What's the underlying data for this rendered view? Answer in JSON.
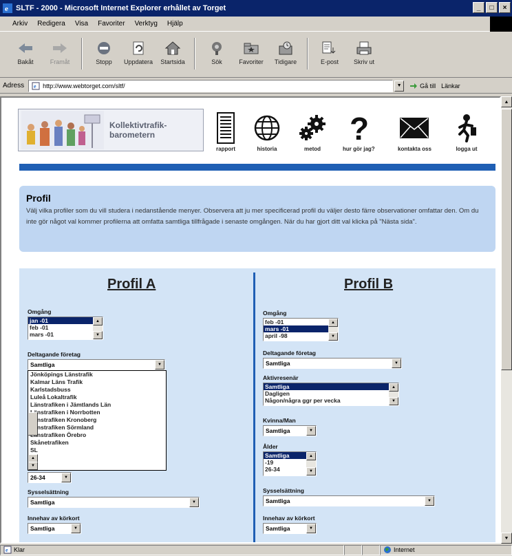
{
  "window": {
    "title": "SLTF - 2000 - Microsoft Internet Explorer erhållet av Torget"
  },
  "menu": [
    "Arkiv",
    "Redigera",
    "Visa",
    "Favoriter",
    "Verktyg",
    "Hjälp"
  ],
  "toolbar": [
    {
      "label": "Bakåt",
      "icon": "back-arrow-icon",
      "enabled": true
    },
    {
      "label": "Framåt",
      "icon": "forward-arrow-icon",
      "enabled": false
    },
    {
      "label": "Stopp",
      "icon": "stop-icon",
      "enabled": true
    },
    {
      "label": "Uppdatera",
      "icon": "refresh-icon",
      "enabled": true
    },
    {
      "label": "Startsida",
      "icon": "home-icon",
      "enabled": true
    },
    {
      "label": "Sök",
      "icon": "search-icon",
      "enabled": true
    },
    {
      "label": "Favoriter",
      "icon": "favorites-icon",
      "enabled": true
    },
    {
      "label": "Tidigare",
      "icon": "history-icon",
      "enabled": true
    },
    {
      "label": "E-post",
      "icon": "mail-icon",
      "enabled": true
    },
    {
      "label": "Skriv ut",
      "icon": "print-icon",
      "enabled": true
    }
  ],
  "address": {
    "label": "Adress",
    "url": "http://www.webtorget.com/sltf/",
    "go": "Gå till",
    "links": "Länkar"
  },
  "status": {
    "left": "Klar",
    "zone": "Internet"
  },
  "site": {
    "logo_line1": "Kollektivtrafik-",
    "logo_line2": "barometern",
    "nav": [
      {
        "label": "rapport",
        "icon": "report-icon"
      },
      {
        "label": "historia",
        "icon": "globe-icon"
      },
      {
        "label": "metod",
        "icon": "gears-icon"
      },
      {
        "label": "hur gör jag?",
        "icon": "question-icon"
      },
      {
        "label": "kontakta oss",
        "icon": "envelope-icon"
      },
      {
        "label": "logga ut",
        "icon": "logout-icon"
      }
    ]
  },
  "intro": {
    "title": "Profil",
    "text": "Välj vilka profiler som du vill studera i nedanstående menyer. Observera att ju mer specificerad profil du väljer desto färre observationer omfattar den. Om du inte gör något val kommer profilerna att omfatta samtliga tillfrågade i senaste omgången. När du har gjort ditt val klicka på \"Nästa sida\"."
  },
  "profileA": {
    "title": "Profil A",
    "omgang_label": "Omgång",
    "omgang_options": [
      {
        "t": "jan -01",
        "sel": true
      },
      {
        "t": "feb -01",
        "sel": false
      },
      {
        "t": "mars -01",
        "sel": false
      }
    ],
    "foretag_label": "Deltagande företag",
    "foretag_value": "Samtliga",
    "foretag_list": [
      "Jönköpings Länstrafik",
      "Kalmar Läns Trafik",
      "Karlstadsbuss",
      "Luleå Lokaltrafik",
      "Länstrafiken i Jämtlands Län",
      "Länstrafiken i Norrbotten",
      "Länstrafiken Kronoberg",
      "Länstrafiken Sörmland",
      "Länstrafiken Örebro",
      "Skånetrafiken",
      "SL"
    ],
    "alder_value": "26-34",
    "syss_label": "Sysselsättning",
    "syss_value": "Samtliga",
    "innehav_label": "Innehav av körkort",
    "innehav_value": "Samtliga"
  },
  "profileB": {
    "title": "Profil B",
    "omgang_label": "Omgång",
    "omgang_options": [
      {
        "t": "feb -01",
        "sel": false
      },
      {
        "t": "mars -01",
        "sel": true
      },
      {
        "t": "april -98",
        "sel": false
      }
    ],
    "foretag_label": "Deltagande företag",
    "foretag_value": "Samtliga",
    "aktivitet_label": "Aktivresenär",
    "aktivitet_options": [
      {
        "t": "Samtliga",
        "sel": true
      },
      {
        "t": "Dagligen",
        "sel": false
      },
      {
        "t": "Någon/några ggr per vecka",
        "sel": false
      }
    ],
    "kvinna_label": "Kvinna/Man",
    "kvinna_value": "Samtliga",
    "alder_label": "Ålder",
    "alder_options": [
      {
        "t": "Samtliga",
        "sel": true
      },
      {
        "t": "-19",
        "sel": false
      },
      {
        "t": "26-34",
        "sel": false
      }
    ],
    "syss_label": "Sysselsättning",
    "syss_value": "Samtliga",
    "innehav_label": "Innehav av körkort",
    "innehav_value": "Samtliga"
  }
}
